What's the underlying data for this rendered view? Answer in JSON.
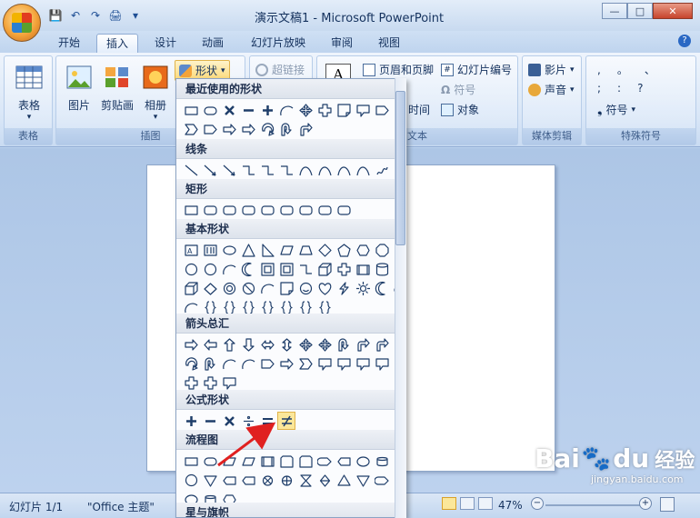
{
  "window": {
    "title": "演示文稿1 - Microsoft PowerPoint",
    "minimize": "—",
    "maximize": "□",
    "close": "✕"
  },
  "qat": {
    "save": "💾",
    "undo": "↶",
    "redo": "↷",
    "print": "🖨",
    "more": "▾"
  },
  "tabs": [
    "开始",
    "插入",
    "设计",
    "动画",
    "幻灯片放映",
    "审阅",
    "视图"
  ],
  "active_tab": "插入",
  "help": "?",
  "ribbon": {
    "table": {
      "label": "表格",
      "group": "表格"
    },
    "illustration": {
      "picture": "图片",
      "clipart": "剪贴画",
      "album": "相册",
      "shapes": "形状",
      "group": "插图"
    },
    "links": {
      "hyperlink": "超链接"
    },
    "text": {
      "textbox": "A",
      "header_footer": "页眉和页脚",
      "slide_number": "幻灯片编号",
      "symbol": "符号",
      "datetime": "时间",
      "object": "对象",
      "group": "文本"
    },
    "media": {
      "movie": "影片",
      "sound": "声音",
      "group": "媒体剪辑"
    },
    "special": {
      "symbols": [
        ",",
        "。",
        "、",
        ";",
        ":",
        "?"
      ],
      "symbol": "符号",
      "group": "特殊符号"
    }
  },
  "dropdown": {
    "sections": [
      "最近使用的形状",
      "线条",
      "矩形",
      "基本形状",
      "箭头总汇",
      "公式形状",
      "流程图",
      "星与旗帜"
    ]
  },
  "statusbar": {
    "slide": "幻灯片 1/1",
    "theme": "\"Office 主题\"",
    "zoom": "47%"
  },
  "watermark": {
    "brand": "Bai",
    "brand2": "du",
    "jingyan": "经验",
    "url": "jingyan.baidu.com"
  },
  "colors": {
    "accent": "#2a68c4",
    "highlight": "#fbe79a",
    "arrow": "#e02020"
  }
}
